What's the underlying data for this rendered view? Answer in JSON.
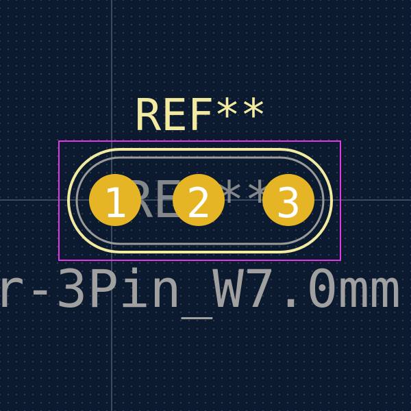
{
  "view": {
    "background_color": "#0b1a2e",
    "grid_dot_color": "#5a6e8c",
    "crosshair_color": "#9aa6b8"
  },
  "footprint": {
    "reference_text": "REF**",
    "value_text_ghost": "REF**",
    "footprint_name_text": "r-3Pin_W7.0mm",
    "pad_numbers": [
      "1",
      "2",
      "3"
    ],
    "colors": {
      "reference": "#f2eaa0",
      "silkscreen_outline": "#f2eaa0",
      "fab_outline": "#9a9a9a",
      "courtyard": "#e03ae6",
      "pad_copper": "#e5b526",
      "pad_hole": "#7a8fa3",
      "pad_label": "#ffffff",
      "footprint_name": "#a0a0a0"
    }
  }
}
